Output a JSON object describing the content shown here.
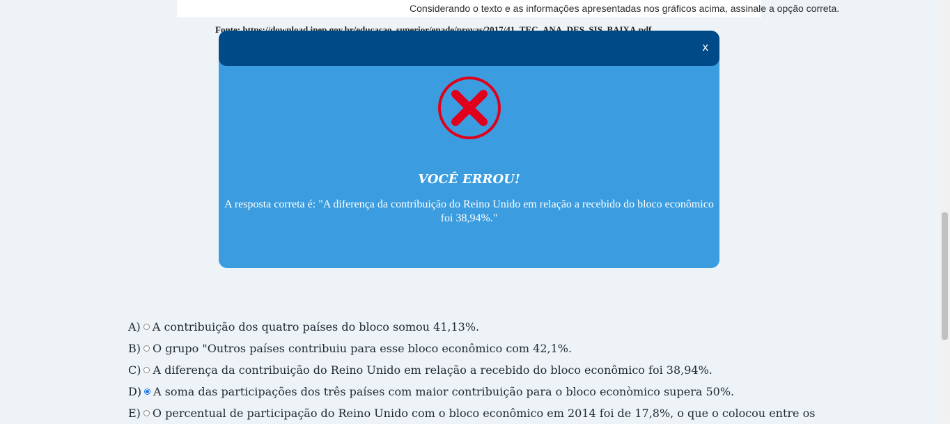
{
  "question": {
    "text": "Considerando o texto e as informações apresentadas nos gráficos acima, assinale a opção correta.",
    "source": "Fonte: https://download.inep.gov.br/educacao_superior/enade/provas/2017/41_TEC_ANA_DES_SIS_BAIXA.pdf"
  },
  "modal": {
    "close_label": "x",
    "icon": "error-x-icon",
    "title": "VOCÊ ERROU!",
    "message": "A resposta correta é: \"A diferença da contribuição do Reino Unido em relação a recebido do bloco econômico foi 38,94%.\""
  },
  "options": [
    {
      "letter": "A)",
      "text": "A contribuição dos quatro países do bloco somou 41,13%.",
      "checked": false
    },
    {
      "letter": "B)",
      "text": "O grupo \"Outros países contribuiu para esse bloco econômico com 42,1%.",
      "checked": false
    },
    {
      "letter": "C)",
      "text": "A diferença da contribuição do Reino Unido em relação a recebido do bloco econômico foi 38,94%.",
      "checked": false
    },
    {
      "letter": "D)",
      "text": "A soma das participações dos três países com maior contribuição para o bloco econòmico supera 50%.",
      "checked": true
    },
    {
      "letter": "E)",
      "text": "O percentual de participação do Reino Unido com o bloco econômico em 2014 foi de 17,8%, o que o colocou entre os",
      "checked": false
    }
  ],
  "colors": {
    "modal_body": "#3b9ddf",
    "modal_header": "#004a87",
    "error_red": "#e0001b"
  }
}
